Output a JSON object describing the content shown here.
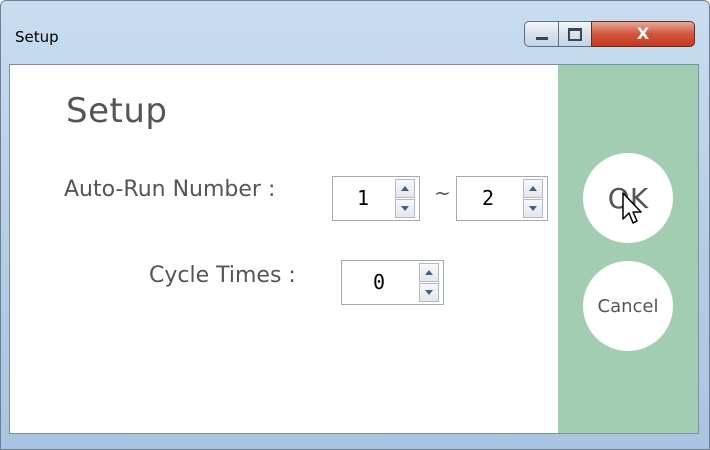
{
  "window": {
    "title": "Setup"
  },
  "caption_buttons": {
    "close_glyph": "X"
  },
  "form": {
    "heading": "Setup",
    "auto_run_label": "Auto-Run Number :",
    "range_separator": "~",
    "auto_run_from": "1",
    "auto_run_to": "2",
    "cycle_label": "Cycle Times :",
    "cycle_value": "0"
  },
  "actions": {
    "ok_label": "OK",
    "cancel_label": "Cancel"
  },
  "colors": {
    "side_panel": "#a3cdb2",
    "close_button": "#c33a21",
    "text": "#555555"
  }
}
